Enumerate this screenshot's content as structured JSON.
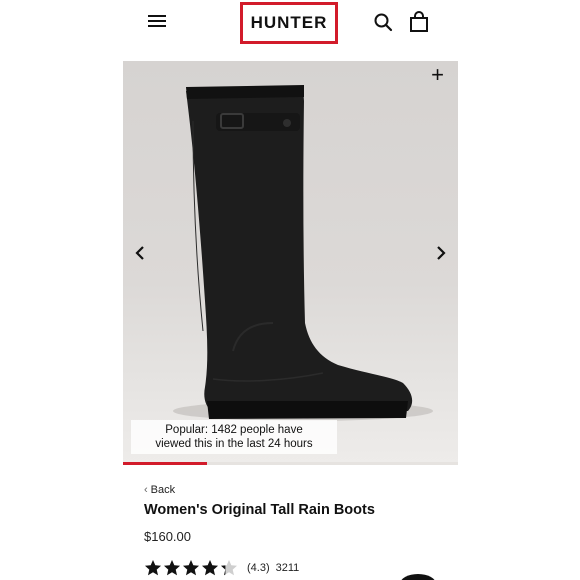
{
  "header": {
    "brand": "HUNTER",
    "brand_color": "#d21b2a",
    "icons": [
      "menu-icon",
      "search-icon",
      "shopping-bag-icon"
    ]
  },
  "gallery": {
    "image": "black-tall-rain-boot",
    "zoom_icon": "plus-icon",
    "prev_icon": "chevron-left-icon",
    "next_icon": "chevron-right-icon",
    "popular_line1": "Popular: 1482 people have",
    "popular_line2": "viewed this in the last 24 hours",
    "progress_fraction": 0.25
  },
  "product": {
    "back_label": "Back",
    "title": "Women's Original Tall Rain Boots",
    "price": "$160.00",
    "rating_value": 4.3,
    "rating_score": "(4.3)",
    "rating_count": "3211"
  }
}
